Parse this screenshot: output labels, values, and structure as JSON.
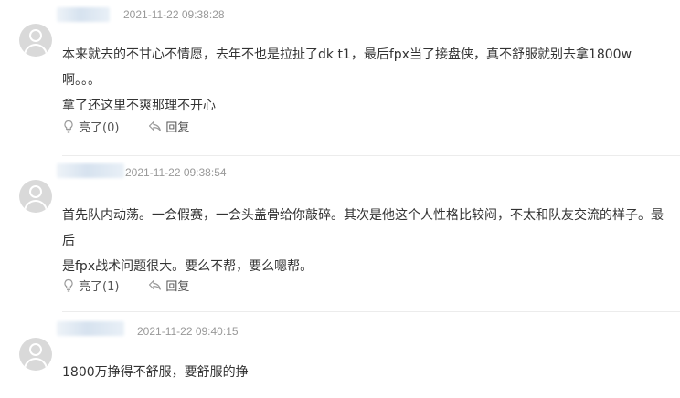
{
  "comments": [
    {
      "time": "2021-11-22 09:38:28",
      "lines": [
        "本来就去的不甘心不情愿，去年不也是拉扯了dk t1，最后fpx当了接盘侠，真不舒服就别去拿1800w啊。。。",
        "拿了还这里不爽那理不开心"
      ],
      "like_label": "亮了(0)",
      "reply_label": "回复"
    },
    {
      "time": "2021-11-22 09:38:54",
      "lines": [
        "首先队内动荡。一会假赛，一会头盖骨给你敲碎。其次是他这个人性格比较闷，不太和队友交流的样子。最后",
        "是fpx战术问题很大。要么不帮，要么嗯帮。"
      ],
      "like_label": "亮了(1)",
      "reply_label": "回复"
    },
    {
      "time": "2021-11-22 09:40:15",
      "lines": [
        "1800万挣得不舒服，要舒服的挣"
      ]
    }
  ],
  "icons": {
    "avatar": "user-avatar-icon",
    "like": "lightbulb-icon",
    "reply": "reply-arrow-icon"
  },
  "colors": {
    "time": "#999999",
    "text": "#333333",
    "action": "#555555",
    "avatar_bg": "#d9d9d9",
    "divider": "#ececec"
  }
}
